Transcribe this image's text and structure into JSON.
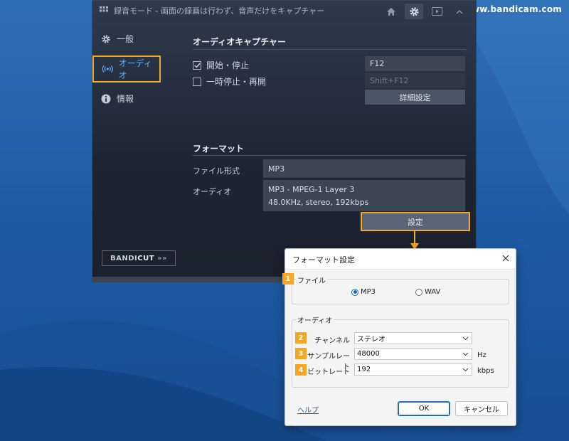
{
  "watermark": "www.bandicam.com",
  "app": {
    "title": "録音モード - 画面の録画は行わず、音声だけをキャプチャー",
    "nav": [
      {
        "label": "一般",
        "icon": "gear-icon"
      },
      {
        "label": "オーディオ",
        "icon": "audio-wave-icon",
        "selected": true
      },
      {
        "label": "情報",
        "icon": "info-icon"
      }
    ],
    "bandicut": {
      "part1": "BANDI",
      "part2": "CUT",
      "arrows": "»»"
    },
    "audio_capture": {
      "title": "オーディオキャプチャー",
      "start_stop": {
        "label": "開始・停止",
        "checked": true,
        "hotkey": "F12"
      },
      "pause_resume": {
        "label": "一時停止・再開",
        "checked": false,
        "hotkey": "Shift+F12"
      },
      "details_button": "詳細設定"
    },
    "format": {
      "title": "フォーマット",
      "file_format_label": "ファイル形式",
      "file_format_value": "MP3",
      "audio_label": "オーディオ",
      "audio_line1": "MP3 - MPEG-1 Layer 3",
      "audio_line2": "48.0KHz, stereo, 192kbps",
      "settings_button": "設定"
    }
  },
  "dialog": {
    "title": "フォーマット設定",
    "file_group": {
      "badge": "1",
      "label": "ファイル",
      "options": [
        "MP3",
        "WAV"
      ],
      "selected": "MP3"
    },
    "audio_group": {
      "label": "オーディオ",
      "channel": {
        "badge": "2",
        "label": "チャンネル",
        "value": "ステレオ"
      },
      "sample_rate": {
        "badge": "3",
        "label": "サンプルレート",
        "value": "48000",
        "unit": "Hz"
      },
      "bitrate": {
        "badge": "4",
        "label": "ビットレート",
        "value": "192",
        "unit": "kbps"
      }
    },
    "help": "ヘルプ",
    "ok": "OK",
    "cancel": "キャンセル"
  },
  "colors": {
    "highlight": "#f5a623",
    "accent_blue": "#6ab2ff",
    "link": "#1a56b3"
  }
}
